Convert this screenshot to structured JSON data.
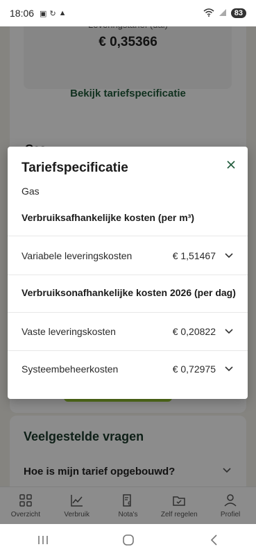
{
  "statusbar": {
    "time": "18:06",
    "battery": "83"
  },
  "background": {
    "leveringstarief_label": "Leveringstarief (dal)",
    "leveringstarief_price": "€ 0,35366",
    "spec_link": "Bekijk tariefspecificatie",
    "gas_title": "Gas",
    "faq_title": "Veelgestelde vragen",
    "faq_question": "Hoe is mijn tarief opgebouwd?"
  },
  "modal": {
    "title": "Tariefspecificatie",
    "subtitle": "Gas",
    "section1": "Verbruiksafhankelijke kosten (per m³)",
    "section2": "Verbruiksonafhankelijke kosten 2026 (per dag)",
    "rows": [
      {
        "label": "Variabele leveringskosten",
        "value": "€ 1,51467"
      },
      {
        "label": "Vaste leveringskosten",
        "value": "€ 0,20822"
      },
      {
        "label": "Systeembeheerkosten",
        "value": "€ 0,72975"
      }
    ]
  },
  "bottom_nav": {
    "items": [
      {
        "label": "Overzicht",
        "icon": "grid-icon"
      },
      {
        "label": "Verbruik",
        "icon": "chart-icon"
      },
      {
        "label": "Nota's",
        "icon": "invoice-icon"
      },
      {
        "label": "Zelf regelen",
        "icon": "folder-check-icon"
      },
      {
        "label": "Profiel",
        "icon": "person-icon"
      }
    ]
  },
  "colors": {
    "brand_green": "#1f5a3a",
    "accent_lime": "#9acd32",
    "overlay": "rgba(0,0,0,0.45)"
  }
}
